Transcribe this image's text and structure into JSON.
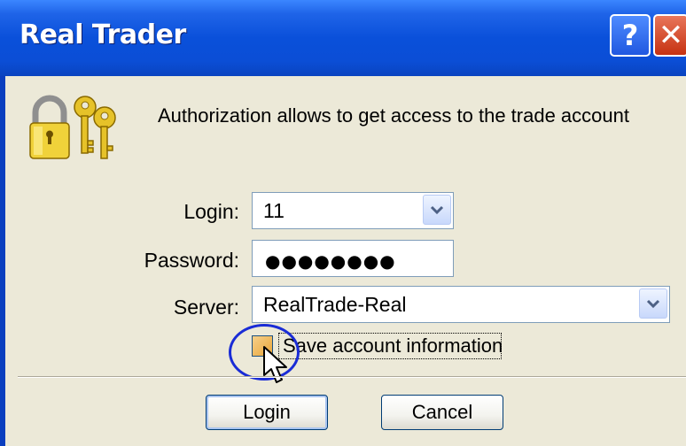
{
  "window": {
    "title": "Real Trader",
    "help_label": "?",
    "close_label": "✕"
  },
  "header": {
    "icon": "lock-keys-icon",
    "message": "Authorization allows to get access to the trade account"
  },
  "form": {
    "login_label": "Login:",
    "login_value": "11",
    "password_label": "Password:",
    "password_mask": "●●●●●●●●",
    "server_label": "Server:",
    "server_value": "RealTrade-Real",
    "save_checkbox_label": "Save account information",
    "save_checked": false
  },
  "buttons": {
    "login": "Login",
    "cancel": "Cancel"
  },
  "colors": {
    "titlebar": "#0a50da",
    "dialog_bg": "#ece9d8",
    "highlight": "#1a2cd6"
  }
}
